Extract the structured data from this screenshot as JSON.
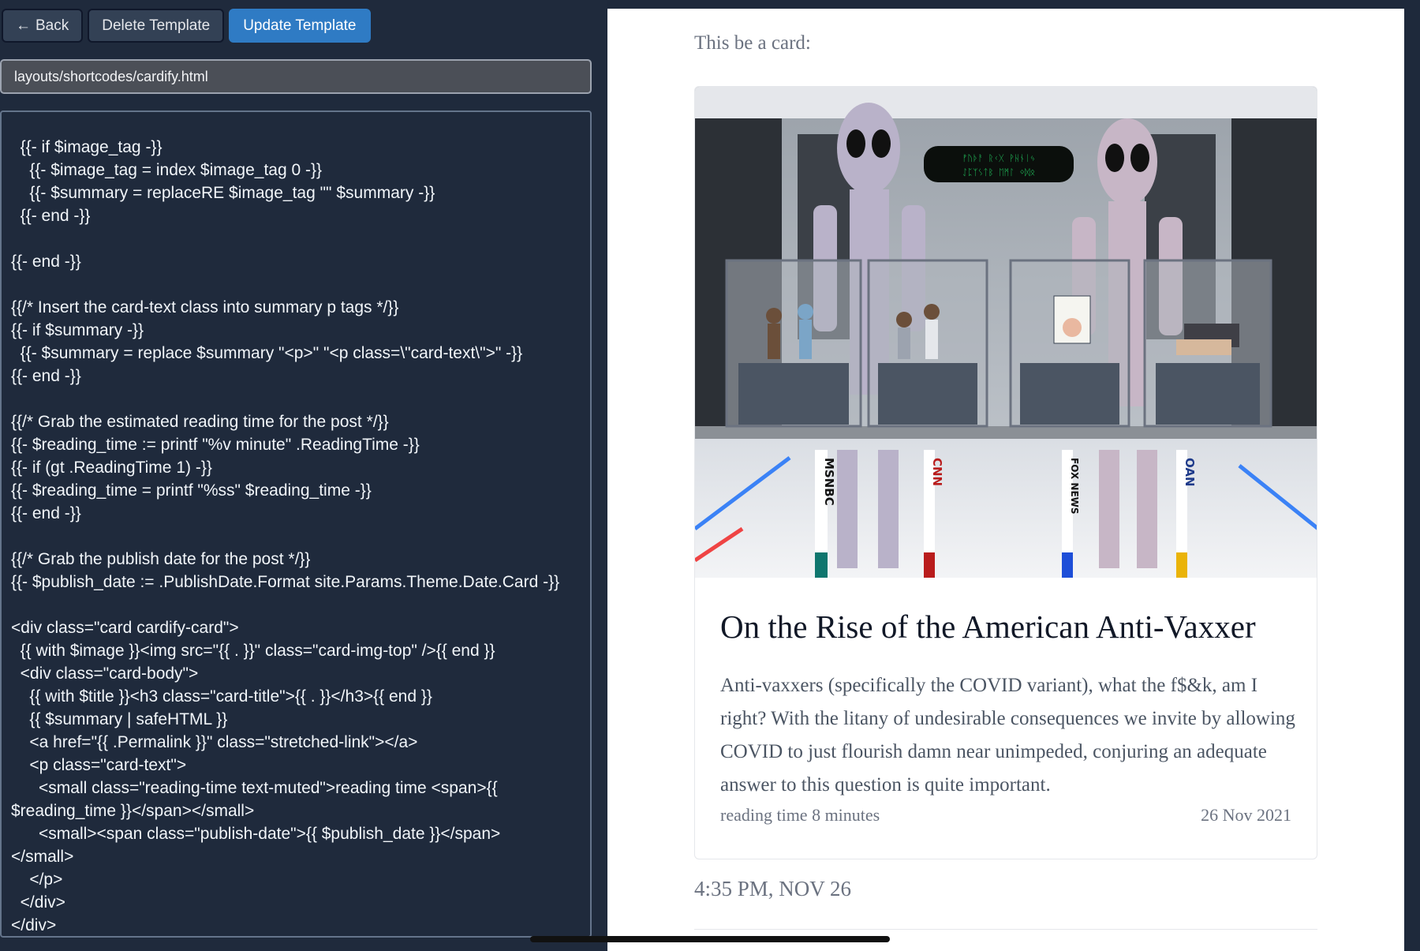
{
  "toolbar": {
    "back_label": "Back",
    "delete_label": "Delete Template",
    "update_label": "Update Template"
  },
  "file_path": "layouts/shortcodes/cardify.html",
  "code_lines": [
    "  {{- if $image_tag -}}",
    "    {{- $image_tag = index $image_tag 0 -}}",
    "    {{- $summary = replaceRE $image_tag \"\" $summary -}}",
    "  {{- end -}}",
    "",
    "{{- end -}}",
    "",
    "{{/* Insert the card-text class into summary p tags */}}",
    "{{- if $summary -}}",
    "  {{- $summary = replace $summary \"<p>\" \"<p class=\\\"card-text\\\">\" -}}",
    "{{- end -}}",
    "",
    "{{/* Grab the estimated reading time for the post */}}",
    "{{- $reading_time := printf \"%v minute\" .ReadingTime -}}",
    "{{- if (gt .ReadingTime 1) -}}",
    "{{- $reading_time = printf \"%ss\" $reading_time -}}",
    "{{- end -}}",
    "",
    "{{/* Grab the publish date for the post */}}",
    "{{- $publish_date := .PublishDate.Format site.Params.Theme.Date.Card -}}",
    "",
    "<div class=\"card cardify-card\">",
    "  {{ with $image }}<img src=\"{{ . }}\" class=\"card-img-top\" />{{ end }}",
    "  <div class=\"card-body\">",
    "    {{ with $title }}<h3 class=\"card-title\">{{ . }}</h3>{{ end }}",
    "    {{ $summary | safeHTML }}",
    "    <a href=\"{{ .Permalink }}\" class=\"stretched-link\"></a>",
    "    <p class=\"card-text\">",
    "      <small class=\"reading-time text-muted\">reading time <span>{{",
    "$reading_time }}</span></small>",
    "      <small><span class=\"publish-date\">{{ $publish_date }}</span>",
    "</small>",
    "    </p>",
    "  </div>",
    "</div>"
  ],
  "preview": {
    "intro": "This be a card:",
    "card": {
      "title": "On the Rise of the American Anti-Vaxxer",
      "summary": "Anti-vaxxers (specifically the COVID variant), what the f$&k, am I right? With the litany of undesirable consequences we invite by allowing COVID to just flourish damn near unimpeded, conjuring an adequate answer to this question is quite important.",
      "reading_time": "reading time 8 minutes",
      "publish_date": "26 Nov 2021",
      "image_labels": [
        "MSNBC",
        "CNN",
        "FOX NEWS",
        "OAN"
      ],
      "speech_text": [
        "ᚠᚢᚦᚨ ᚱᚲᚷ ᚹᚺᚾᛁᛃ",
        "ᛇᛈᛉᛊᛏᛒ ᛖᛗᛚ ᛜᛞᛟ"
      ]
    },
    "timestamp": "4:35 PM, NOV 26"
  }
}
